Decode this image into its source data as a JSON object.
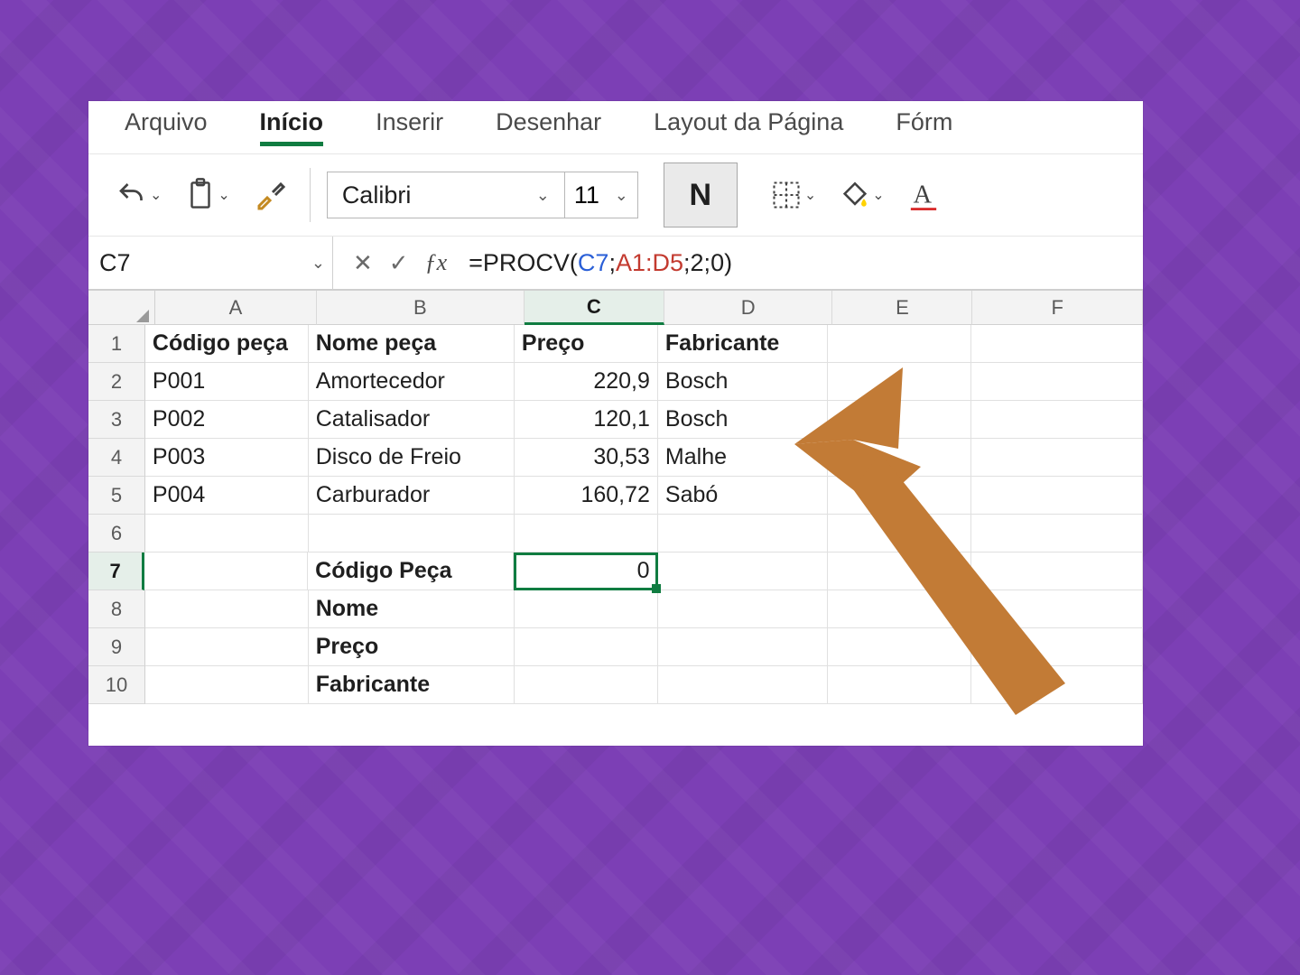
{
  "ribbon": {
    "tabs": [
      "Arquivo",
      "Início",
      "Inserir",
      "Desenhar",
      "Layout da Página",
      "Fórm"
    ],
    "active_index": 1
  },
  "toolbar": {
    "font_name": "Calibri",
    "font_size": "11",
    "bold_label": "N"
  },
  "formula_bar": {
    "name_box": "C7",
    "formula_prefix": "=PROCV(",
    "arg1": "C7",
    "sep1": ";",
    "arg2": "A1:D5",
    "sep2": ";",
    "arg3": "2",
    "sep3": ";",
    "arg4": "0",
    "suffix": ")"
  },
  "columns": [
    "A",
    "B",
    "C",
    "D",
    "E",
    "F"
  ],
  "selected_column_index": 2,
  "rows": [
    1,
    2,
    3,
    4,
    5,
    6,
    7,
    8,
    9,
    10
  ],
  "selected_row_index": 6,
  "selected_cell": "C7",
  "sheet": {
    "headers": {
      "A": "Código peça",
      "B": "Nome peça",
      "C": "Preço",
      "D": "Fabricante"
    },
    "data": [
      {
        "A": "P001",
        "B": "Amortecedor",
        "C": "220,9",
        "D": "Bosch"
      },
      {
        "A": "P002",
        "B": "Catalisador",
        "C": "120,1",
        "D": "Bosch"
      },
      {
        "A": "P003",
        "B": "Disco de Freio",
        "C": "30,53",
        "D": "Malhe"
      },
      {
        "A": "P004",
        "B": "Carburador",
        "C": "160,72",
        "D": "Sabó"
      }
    ],
    "lookup_block": {
      "B7": "Código Peça",
      "C7": "0",
      "B8": "Nome",
      "B9": "Preço",
      "B10": "Fabricante"
    }
  }
}
